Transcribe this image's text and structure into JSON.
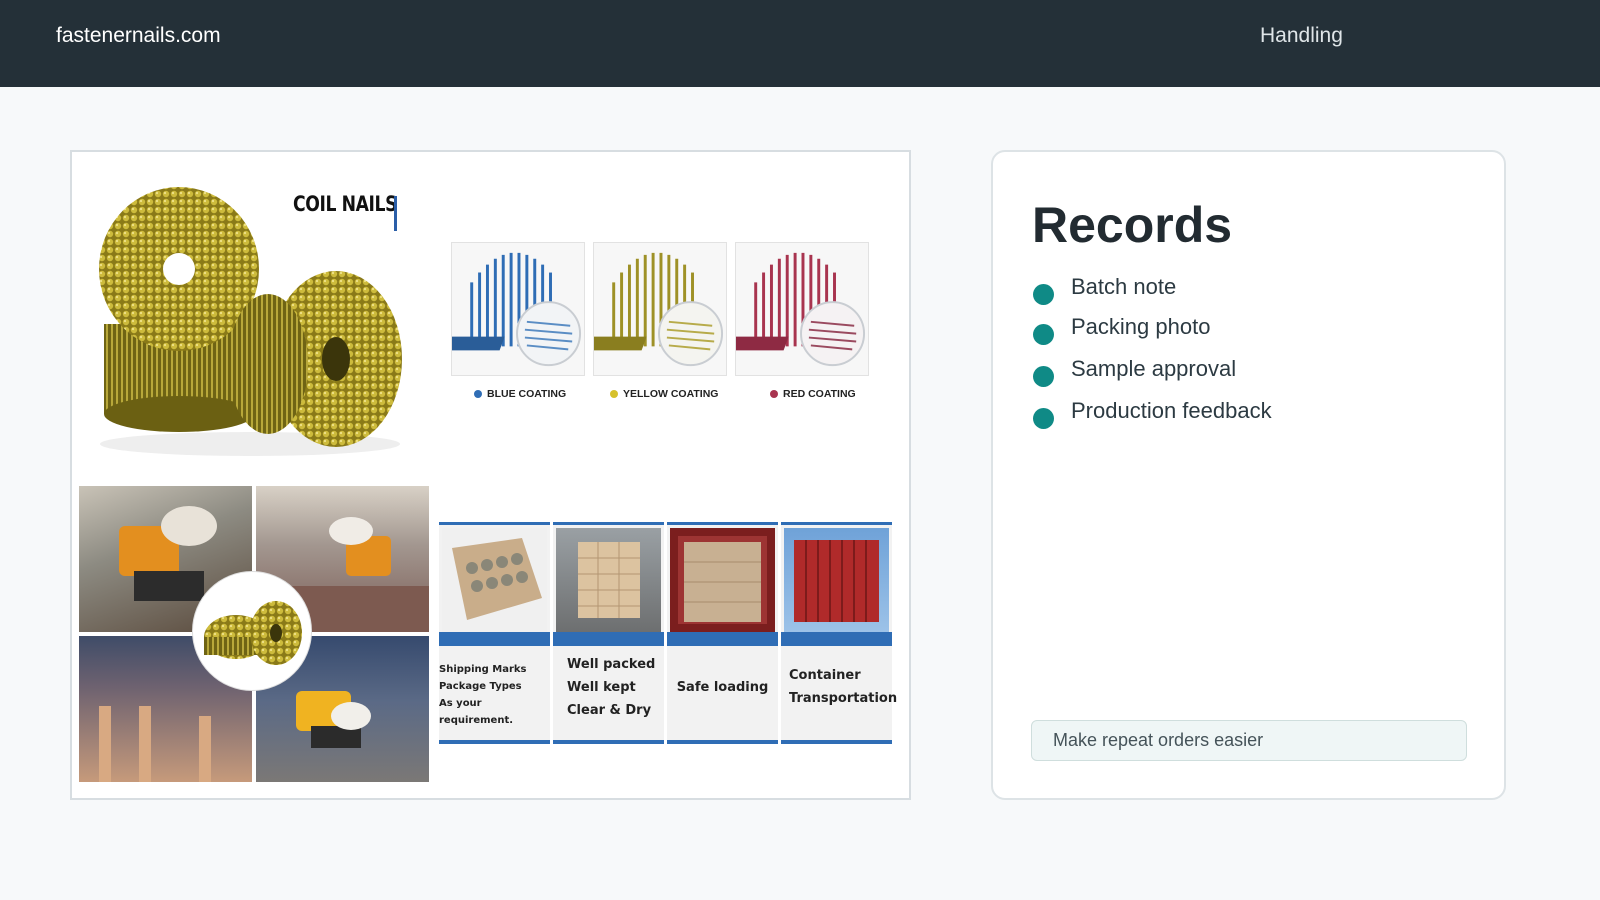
{
  "header": {
    "site_name": "fastenernails.com",
    "nav_link": "Handling"
  },
  "product_image": {
    "title": "COIL NAILS",
    "coatings": [
      {
        "label": "BLUE COATING",
        "color": "#2f6db5"
      },
      {
        "label": "YELLOW COATING",
        "color": "#d6c12c"
      },
      {
        "label": "RED COATING",
        "color": "#a8344f"
      }
    ],
    "packaging_steps": [
      {
        "lines": [
          "Shipping Marks",
          "Package Types",
          "As your requirement."
        ]
      },
      {
        "lines": [
          "Well packed",
          "Well kept",
          "Clear & Dry"
        ]
      },
      {
        "lines": [
          "Safe loading"
        ]
      },
      {
        "lines": [
          "Container",
          "Transportation"
        ]
      }
    ]
  },
  "records": {
    "title": "Records",
    "items": [
      "Batch note",
      "Packing photo",
      "Sample approval",
      "Production feedback"
    ],
    "cta": "Make repeat orders easier",
    "bullet_color": "#0f8a86"
  }
}
